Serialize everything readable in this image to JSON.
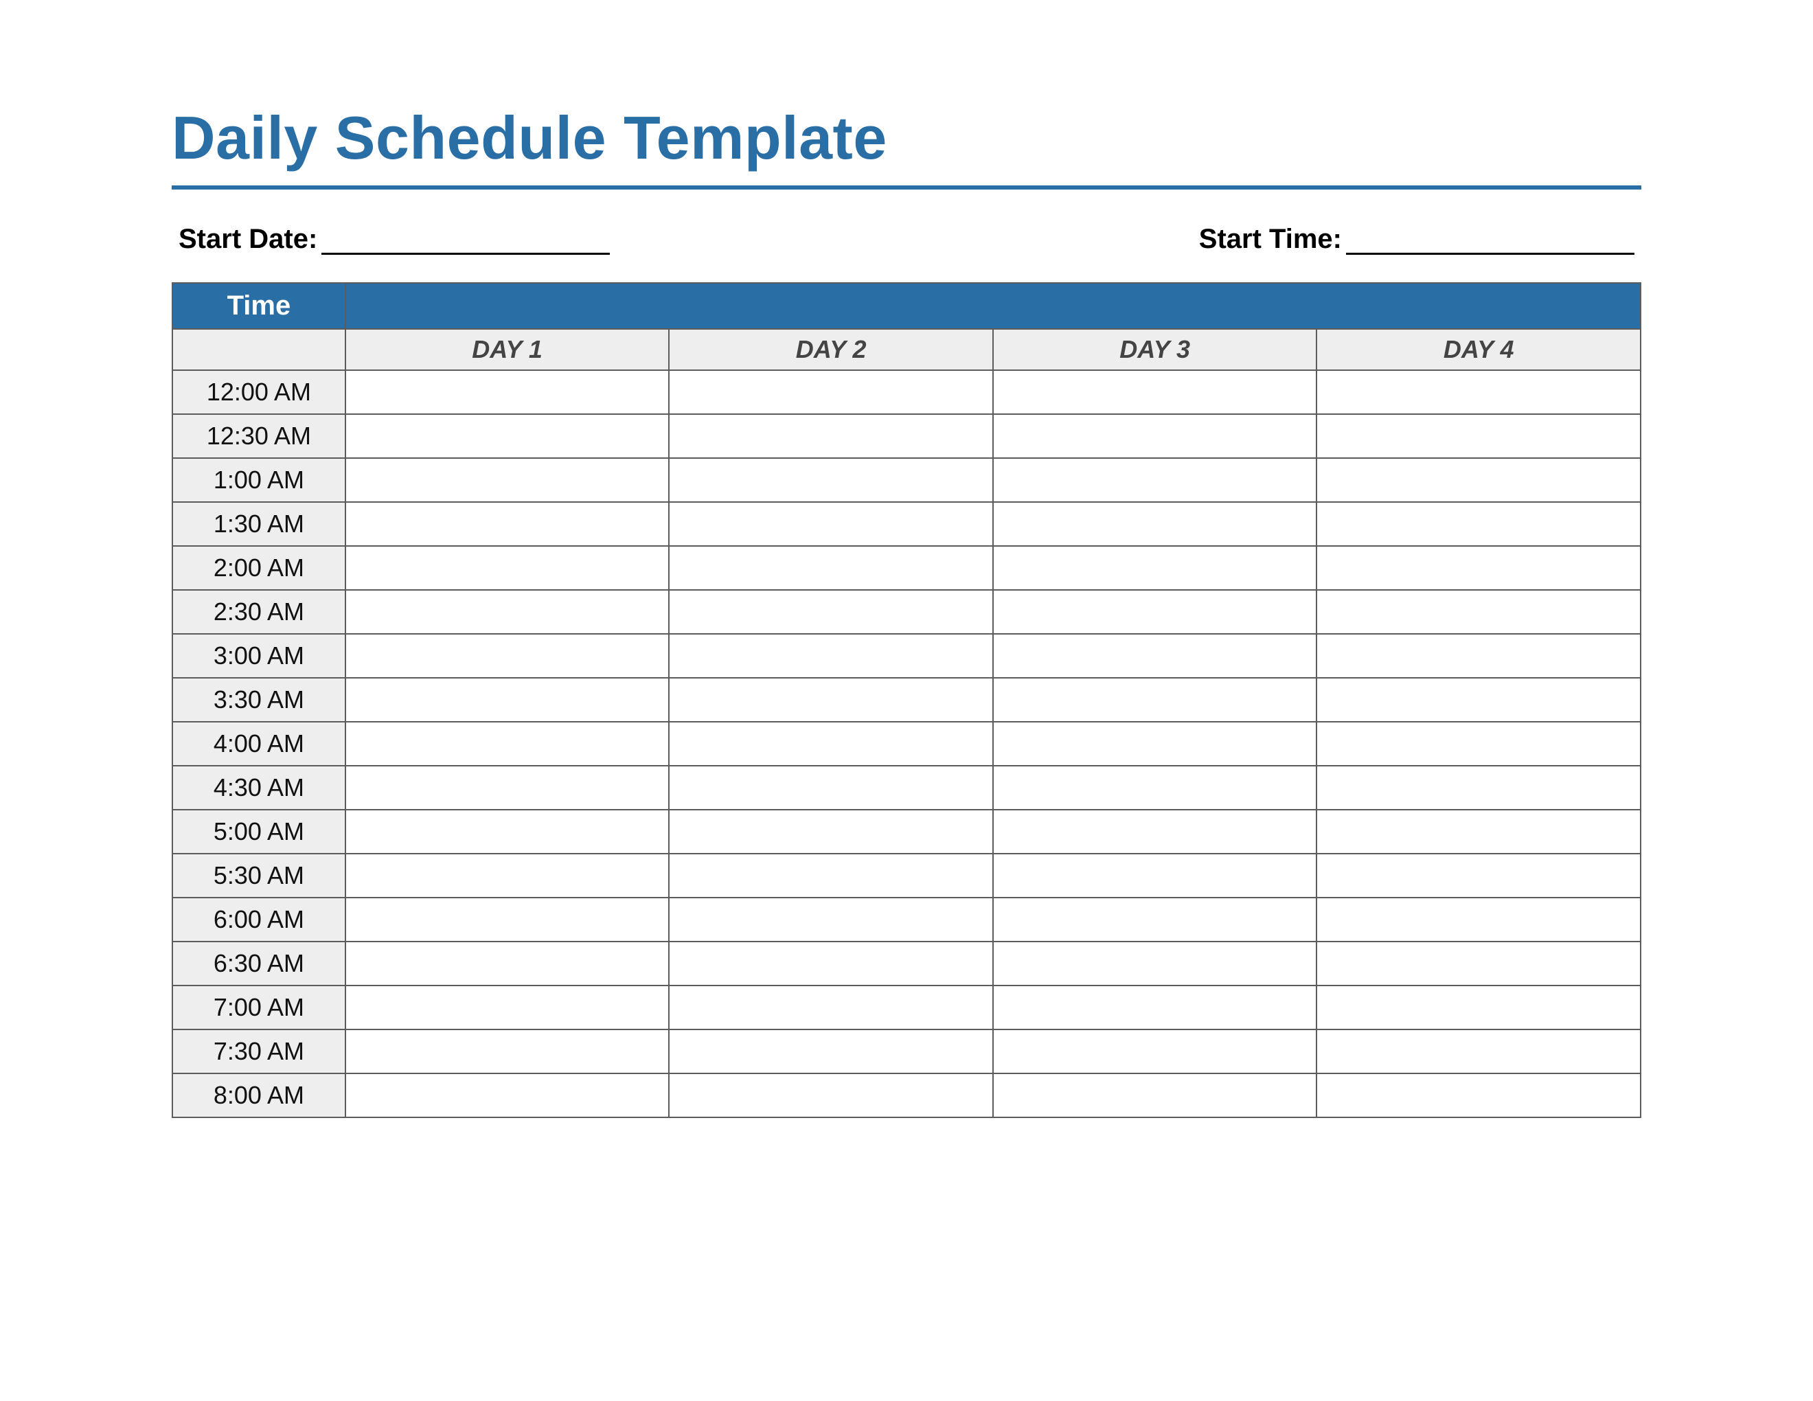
{
  "title": "Daily Schedule Template",
  "meta": {
    "start_date_label": "Start Date:",
    "start_date_value": "",
    "start_time_label": "Start Time:",
    "start_time_value": ""
  },
  "table": {
    "time_header": "Time",
    "day_headers": [
      "DAY 1",
      "DAY 2",
      "DAY 3",
      "DAY 4"
    ],
    "time_slots": [
      "12:00 AM",
      "12:30 AM",
      "1:00 AM",
      "1:30 AM",
      "2:00 AM",
      "2:30 AM",
      "3:00 AM",
      "3:30 AM",
      "4:00 AM",
      "4:30 AM",
      "5:00 AM",
      "5:30 AM",
      "6:00 AM",
      "6:30 AM",
      "7:00 AM",
      "7:30 AM",
      "8:00 AM"
    ]
  },
  "colors": {
    "accent": "#2a6ea6",
    "grid_border": "#5c5c5c",
    "row_shade": "#eeeeee"
  }
}
